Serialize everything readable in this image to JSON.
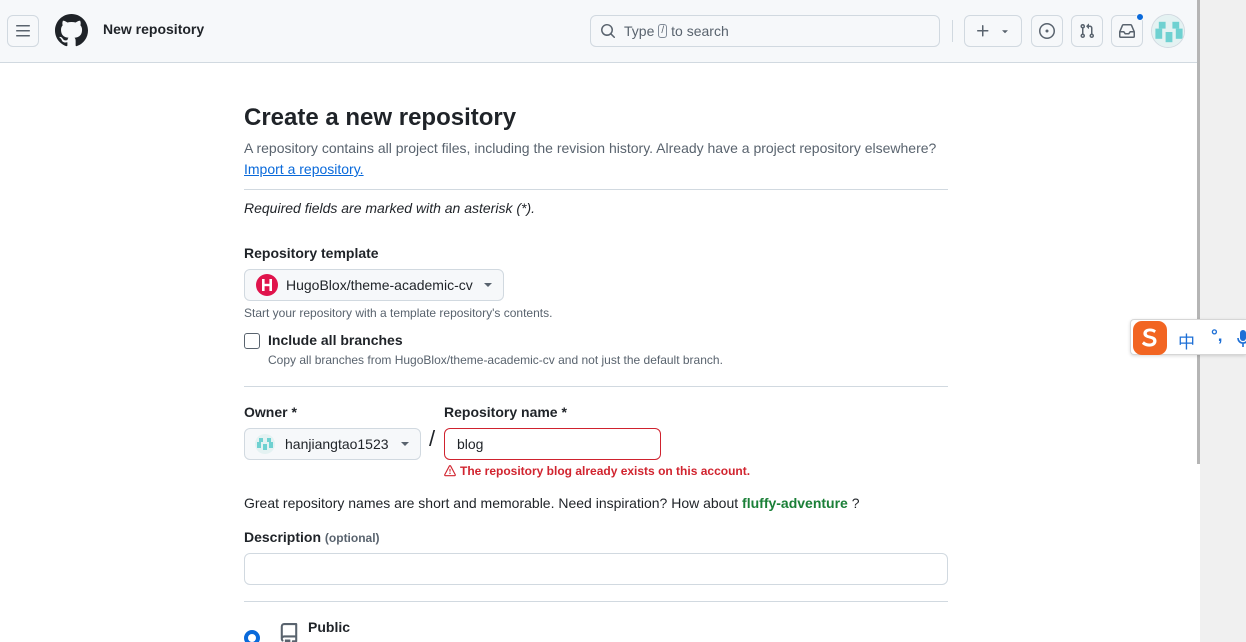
{
  "header": {
    "title": "New repository",
    "search_prefix": "Type",
    "search_key": "/",
    "search_suffix": "to search"
  },
  "page": {
    "title": "Create a new repository",
    "subtitle": "A repository contains all project files, including the revision history. Already have a project repository elsewhere?",
    "import_link": "Import a repository.",
    "required_note": "Required fields are marked with an asterisk (*)."
  },
  "template": {
    "label": "Repository template",
    "selected": "HugoBlox/theme-academic-cv",
    "hint": "Start your repository with a template repository's contents.",
    "include_branches_label": "Include all branches",
    "include_branches_hint": "Copy all branches from HugoBlox/theme-academic-cv and not just the default branch."
  },
  "owner": {
    "label": "Owner *",
    "selected": "hanjiangtao1523"
  },
  "repo_name": {
    "label": "Repository name *",
    "value": "blog",
    "error": "The repository blog already exists on this account."
  },
  "inspiration": {
    "text": "Great repository names are short and memorable. Need inspiration? How about",
    "suggestion": "fluffy-adventure",
    "suffix": "?"
  },
  "description": {
    "label": "Description",
    "optional": "(optional)",
    "value": ""
  },
  "visibility": {
    "public_label": "Public"
  },
  "ime": {
    "lang": "中",
    "punct": "°,"
  },
  "colors": {
    "link": "#0969da",
    "error": "#d1242f",
    "success": "#1a7f37",
    "ime_orange": "#f26522"
  }
}
